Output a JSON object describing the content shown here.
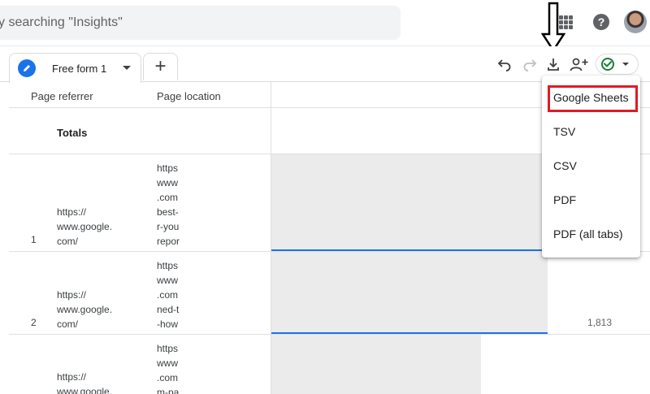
{
  "search": {
    "placeholder_visible": "y searching \"Insights\""
  },
  "header_icons": {
    "apps": "apps-grid-icon",
    "help": "help-icon",
    "help_glyph": "?",
    "avatar": "account-avatar"
  },
  "tab": {
    "label": "Free form 1",
    "add_label": "+"
  },
  "toolbar": {
    "undo": "undo-icon",
    "redo": "redo-icon",
    "download": "download-icon",
    "share": "share-icon",
    "status": "check-circle-icon"
  },
  "table": {
    "columns": [
      "Page referrer",
      "Page location"
    ],
    "totals_label": "Totals",
    "rows": [
      {
        "index": "1",
        "referrer": "https://\nwww.google.\ncom/",
        "location": "https\nwww\n.com\nbest-\nr-you\nrepor",
        "value": ""
      },
      {
        "index": "2",
        "referrer": "https://\nwww.google.\ncom/",
        "location": "https\nwww\n.com\nned-t\n-how",
        "value": "1,813"
      },
      {
        "index": "",
        "referrer": "https://\nwww.google.",
        "location": "https\nwww\n.com\nm-pa",
        "value": ""
      }
    ]
  },
  "export_menu": {
    "items": [
      "Google Sheets",
      "TSV",
      "CSV",
      "PDF",
      "PDF (all tabs)"
    ],
    "highlighted": "Google Sheets",
    "highlight_color": "#e01b24"
  },
  "colors": {
    "accent": "#1a73e8",
    "status_green": "#188038",
    "bar_fill": "#ebebeb"
  }
}
